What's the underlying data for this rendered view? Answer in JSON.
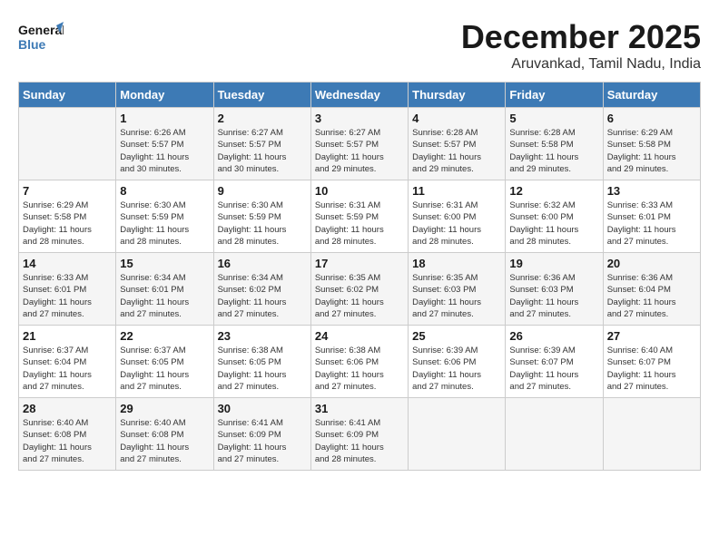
{
  "header": {
    "logo_text_general": "General",
    "logo_text_blue": "Blue",
    "month_title": "December 2025",
    "location": "Aruvankad, Tamil Nadu, India"
  },
  "weekdays": [
    "Sunday",
    "Monday",
    "Tuesday",
    "Wednesday",
    "Thursday",
    "Friday",
    "Saturday"
  ],
  "weeks": [
    [
      {
        "day": "",
        "info": ""
      },
      {
        "day": "1",
        "info": "Sunrise: 6:26 AM\nSunset: 5:57 PM\nDaylight: 11 hours\nand 30 minutes."
      },
      {
        "day": "2",
        "info": "Sunrise: 6:27 AM\nSunset: 5:57 PM\nDaylight: 11 hours\nand 30 minutes."
      },
      {
        "day": "3",
        "info": "Sunrise: 6:27 AM\nSunset: 5:57 PM\nDaylight: 11 hours\nand 29 minutes."
      },
      {
        "day": "4",
        "info": "Sunrise: 6:28 AM\nSunset: 5:57 PM\nDaylight: 11 hours\nand 29 minutes."
      },
      {
        "day": "5",
        "info": "Sunrise: 6:28 AM\nSunset: 5:58 PM\nDaylight: 11 hours\nand 29 minutes."
      },
      {
        "day": "6",
        "info": "Sunrise: 6:29 AM\nSunset: 5:58 PM\nDaylight: 11 hours\nand 29 minutes."
      }
    ],
    [
      {
        "day": "7",
        "info": "Sunrise: 6:29 AM\nSunset: 5:58 PM\nDaylight: 11 hours\nand 28 minutes."
      },
      {
        "day": "8",
        "info": "Sunrise: 6:30 AM\nSunset: 5:59 PM\nDaylight: 11 hours\nand 28 minutes."
      },
      {
        "day": "9",
        "info": "Sunrise: 6:30 AM\nSunset: 5:59 PM\nDaylight: 11 hours\nand 28 minutes."
      },
      {
        "day": "10",
        "info": "Sunrise: 6:31 AM\nSunset: 5:59 PM\nDaylight: 11 hours\nand 28 minutes."
      },
      {
        "day": "11",
        "info": "Sunrise: 6:31 AM\nSunset: 6:00 PM\nDaylight: 11 hours\nand 28 minutes."
      },
      {
        "day": "12",
        "info": "Sunrise: 6:32 AM\nSunset: 6:00 PM\nDaylight: 11 hours\nand 28 minutes."
      },
      {
        "day": "13",
        "info": "Sunrise: 6:33 AM\nSunset: 6:01 PM\nDaylight: 11 hours\nand 27 minutes."
      }
    ],
    [
      {
        "day": "14",
        "info": "Sunrise: 6:33 AM\nSunset: 6:01 PM\nDaylight: 11 hours\nand 27 minutes."
      },
      {
        "day": "15",
        "info": "Sunrise: 6:34 AM\nSunset: 6:01 PM\nDaylight: 11 hours\nand 27 minutes."
      },
      {
        "day": "16",
        "info": "Sunrise: 6:34 AM\nSunset: 6:02 PM\nDaylight: 11 hours\nand 27 minutes."
      },
      {
        "day": "17",
        "info": "Sunrise: 6:35 AM\nSunset: 6:02 PM\nDaylight: 11 hours\nand 27 minutes."
      },
      {
        "day": "18",
        "info": "Sunrise: 6:35 AM\nSunset: 6:03 PM\nDaylight: 11 hours\nand 27 minutes."
      },
      {
        "day": "19",
        "info": "Sunrise: 6:36 AM\nSunset: 6:03 PM\nDaylight: 11 hours\nand 27 minutes."
      },
      {
        "day": "20",
        "info": "Sunrise: 6:36 AM\nSunset: 6:04 PM\nDaylight: 11 hours\nand 27 minutes."
      }
    ],
    [
      {
        "day": "21",
        "info": "Sunrise: 6:37 AM\nSunset: 6:04 PM\nDaylight: 11 hours\nand 27 minutes."
      },
      {
        "day": "22",
        "info": "Sunrise: 6:37 AM\nSunset: 6:05 PM\nDaylight: 11 hours\nand 27 minutes."
      },
      {
        "day": "23",
        "info": "Sunrise: 6:38 AM\nSunset: 6:05 PM\nDaylight: 11 hours\nand 27 minutes."
      },
      {
        "day": "24",
        "info": "Sunrise: 6:38 AM\nSunset: 6:06 PM\nDaylight: 11 hours\nand 27 minutes."
      },
      {
        "day": "25",
        "info": "Sunrise: 6:39 AM\nSunset: 6:06 PM\nDaylight: 11 hours\nand 27 minutes."
      },
      {
        "day": "26",
        "info": "Sunrise: 6:39 AM\nSunset: 6:07 PM\nDaylight: 11 hours\nand 27 minutes."
      },
      {
        "day": "27",
        "info": "Sunrise: 6:40 AM\nSunset: 6:07 PM\nDaylight: 11 hours\nand 27 minutes."
      }
    ],
    [
      {
        "day": "28",
        "info": "Sunrise: 6:40 AM\nSunset: 6:08 PM\nDaylight: 11 hours\nand 27 minutes."
      },
      {
        "day": "29",
        "info": "Sunrise: 6:40 AM\nSunset: 6:08 PM\nDaylight: 11 hours\nand 27 minutes."
      },
      {
        "day": "30",
        "info": "Sunrise: 6:41 AM\nSunset: 6:09 PM\nDaylight: 11 hours\nand 27 minutes."
      },
      {
        "day": "31",
        "info": "Sunrise: 6:41 AM\nSunset: 6:09 PM\nDaylight: 11 hours\nand 28 minutes."
      },
      {
        "day": "",
        "info": ""
      },
      {
        "day": "",
        "info": ""
      },
      {
        "day": "",
        "info": ""
      }
    ]
  ]
}
